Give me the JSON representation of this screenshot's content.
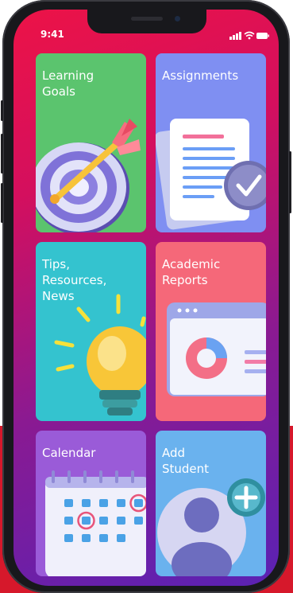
{
  "status_bar": {
    "time": "9:41"
  },
  "tiles": [
    {
      "id": "learning-goals",
      "title": "Learning\nGoals",
      "color": "#5bc46e",
      "icon": "target-icon"
    },
    {
      "id": "assignments",
      "title": "Assignments",
      "color": "#7f8ff2",
      "icon": "document-check-icon"
    },
    {
      "id": "tips",
      "title": "Tips,\nResources,\nNews",
      "color": "#34c3cf",
      "icon": "lightbulb-icon"
    },
    {
      "id": "academic-reports",
      "title": "Academic\nReports",
      "color": "#f56879",
      "icon": "report-chart-icon"
    },
    {
      "id": "calendar",
      "title": "Calendar",
      "color": "#9a5bd8",
      "icon": "calendar-icon"
    },
    {
      "id": "add-student",
      "title": "Add\nStudent",
      "color": "#6ab2ee",
      "icon": "add-user-icon"
    }
  ]
}
